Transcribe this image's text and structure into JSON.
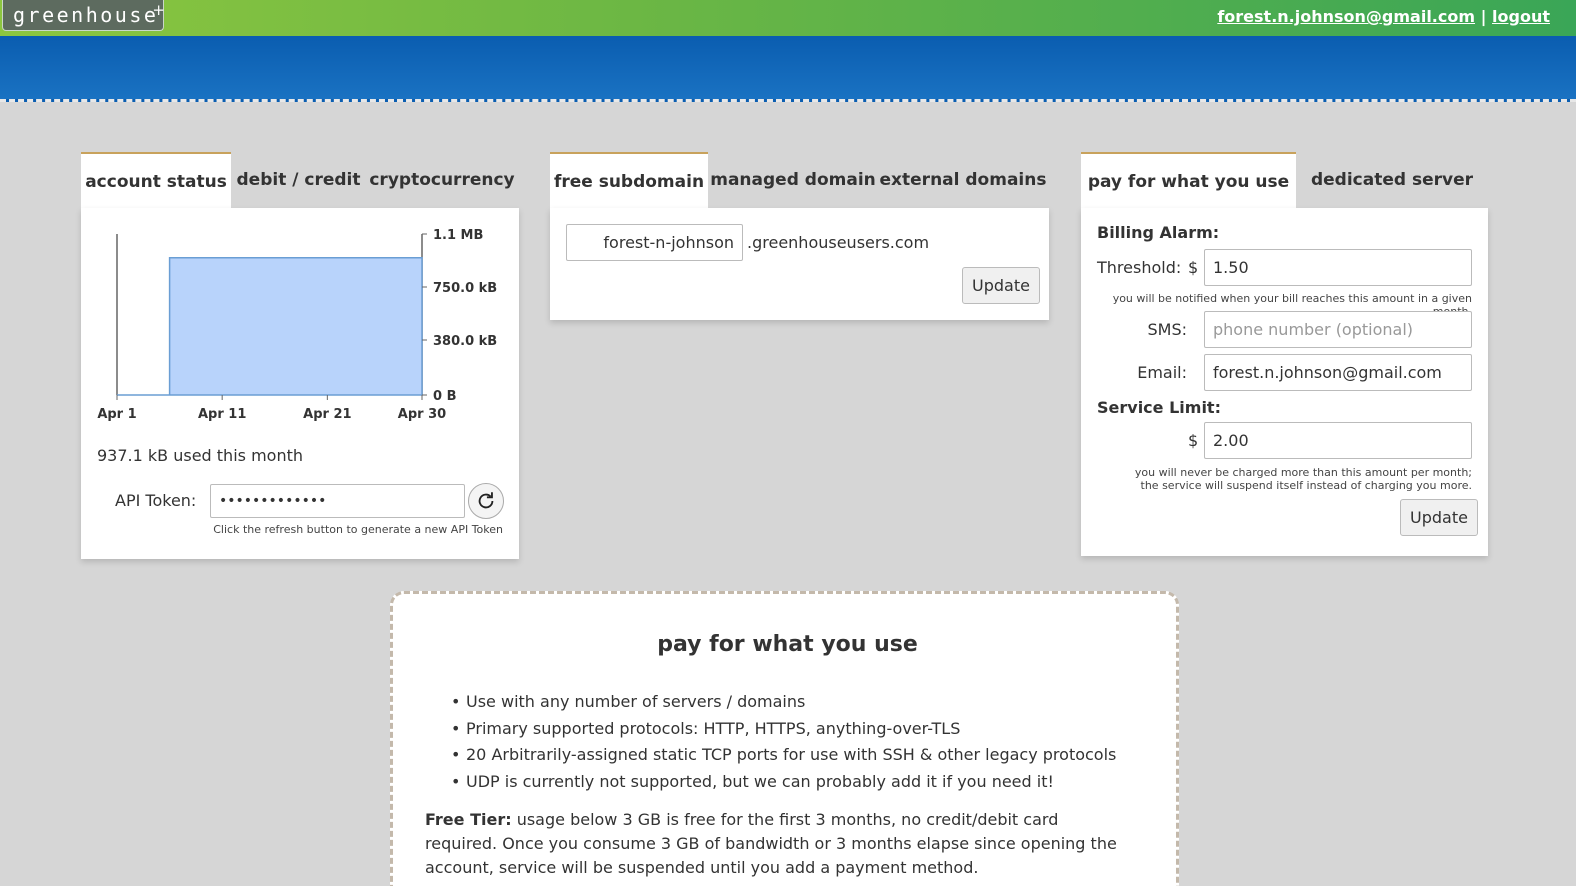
{
  "header": {
    "logo": "greenhouse",
    "logo_mark": "+",
    "user_email": "forest.n.johnson@gmail.com",
    "separator": "|",
    "logout": "logout"
  },
  "account_panel": {
    "tabs": [
      {
        "label": "account status",
        "active": true
      },
      {
        "label": "debit / credit",
        "active": false
      },
      {
        "label": "cryptocurrency",
        "active": false
      }
    ],
    "usage_text": "937.1 kB used this month",
    "api_label": "API Token:",
    "api_value": "•••••••••••••",
    "api_hint": "Click the refresh button to generate a new API Token"
  },
  "chart_data": {
    "type": "area",
    "x": [
      "Apr 1",
      "Apr 6",
      "Apr 6",
      "Apr 30"
    ],
    "x_ticks": [
      "Apr 1",
      "Apr 11",
      "Apr 21",
      "Apr 30"
    ],
    "y_ticks": [
      "1.1 MB",
      "750.0 kB",
      "380.0 kB",
      "0 B"
    ],
    "y_values_kb": [
      0,
      0,
      937.1,
      937.1
    ],
    "ylim_kb": [
      0,
      1100
    ],
    "fill": "#b8d3fb",
    "stroke": "#6a9ed4"
  },
  "domain_panel": {
    "tabs": [
      {
        "label": "free subdomain",
        "active": true
      },
      {
        "label": "managed domain",
        "active": false
      },
      {
        "label": "external domains",
        "active": false
      }
    ],
    "subdomain_value": "forest-n-johnson",
    "suffix": ".greenhouseusers.com",
    "update": "Update"
  },
  "billing_panel": {
    "tabs": [
      {
        "label": "pay for what you use",
        "active": true
      },
      {
        "label": "dedicated server",
        "active": false
      }
    ],
    "billing_alarm": "Billing Alarm:",
    "threshold_label": "Threshold:",
    "currency": "$",
    "threshold_value": "1.50",
    "threshold_hint": "you will be notified when your bill reaches this amount in a given month.",
    "sms_label": "SMS:",
    "sms_placeholder": "phone number (optional)",
    "email_label": "Email:",
    "email_value": "forest.n.johnson@gmail.com",
    "service_limit": "Service Limit:",
    "limit_value": "2.00",
    "limit_hint_1": "you will never be charged more than this amount per month;",
    "limit_hint_2": "the service will suspend itself instead of charging you more.",
    "update": "Update"
  },
  "info_box": {
    "title": "pay for what you use",
    "bullets": [
      "Use with any number of servers / domains",
      "Primary supported protocols: HTTP, HTTPS, anything-over-TLS",
      "20 Arbitrarily-assigned static TCP ports for use with SSH & other legacy protocols",
      "UDP is currently not supported, but we can probably add it if you need it!"
    ],
    "free_tier_label": "Free Tier:",
    "free_tier_text": " usage below 3 GB is free for the first 3 months, no credit/debit card required. Once you consume 3 GB of bandwidth or 3 months elapse since opening the account, service will be suspended until you add a payment method."
  }
}
